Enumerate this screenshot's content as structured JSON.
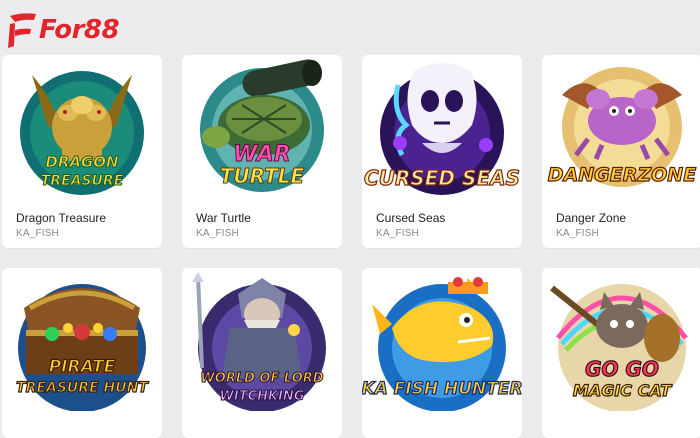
{
  "brand": {
    "logo_text": "For88",
    "logo_color": "#e2242b"
  },
  "games": [
    {
      "name": "Dragon Treasure",
      "provider": "KA_FISH",
      "art_title": "DRAGON TREASURE"
    },
    {
      "name": "War Turtle",
      "provider": "KA_FISH",
      "art_title": "WAR TURTLE"
    },
    {
      "name": "Cursed Seas",
      "provider": "KA_FISH",
      "art_title": "CURSED SEAS"
    },
    {
      "name": "Danger Zone",
      "provider": "KA_FISH",
      "art_title": "DANGERZONE"
    },
    {
      "name": "",
      "provider": "",
      "art_title": "PIRATE TREASURE HUNT"
    },
    {
      "name": "",
      "provider": "",
      "art_title": "WORLD OF LORD WITCHKING"
    },
    {
      "name": "",
      "provider": "",
      "art_title": "KA FISH HUNTER"
    },
    {
      "name": "",
      "provider": "",
      "art_title": "GO GO MAGIC CAT"
    }
  ]
}
